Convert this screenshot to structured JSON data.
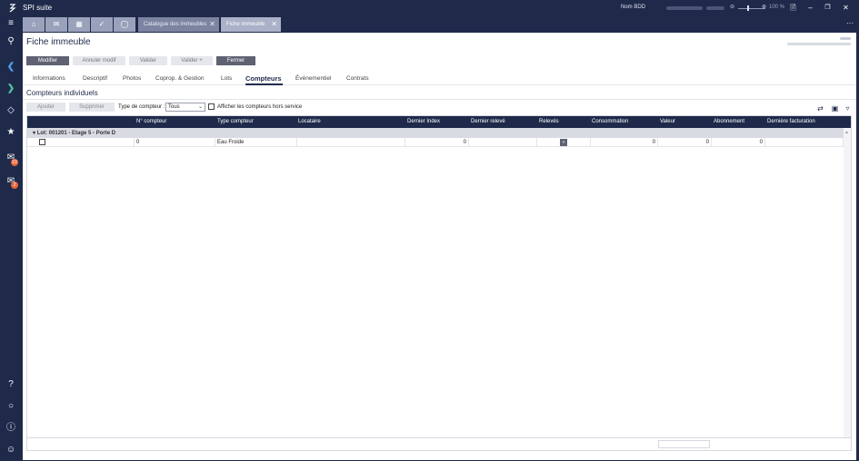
{
  "app": {
    "name": "SPI suite"
  },
  "titlebar": {
    "bdd_label": "Nom BDD",
    "zoom": "100 %",
    "zoom_minus": "⊖",
    "zoom_plus": "⊕",
    "icons": [
      "document-icon",
      "minimize-icon",
      "restore-icon",
      "close-icon"
    ]
  },
  "tabs": {
    "icon_tabs": [
      "home-icon",
      "mail-icon",
      "calendar-icon",
      "check-icon",
      "bell-icon"
    ],
    "doc_tabs": [
      {
        "label": "Catalogue des immeubles",
        "active": false
      },
      {
        "label": "Fiche immeuble",
        "active": true
      }
    ],
    "close_glyph": "✕",
    "more_glyph": "···"
  },
  "sidebar": {
    "badges": {
      "chat": "10",
      "mail": "2"
    }
  },
  "page": {
    "title": "Fiche immeuble",
    "actions": [
      {
        "label": "Modifier",
        "style": "dark"
      },
      {
        "label": "Annuler modif",
        "style": "light"
      },
      {
        "label": "Valider",
        "style": "light"
      },
      {
        "label": "Valider +",
        "style": "light"
      },
      {
        "label": "Fermer",
        "style": "dark"
      }
    ],
    "section_tabs": [
      "Informations",
      "Descriptif",
      "Photos",
      "Coprop. & Gestion",
      "Lots",
      "Compteurs",
      "Événementiel",
      "Contrats"
    ],
    "active_section": "Compteurs"
  },
  "compteurs": {
    "title": "Compteurs individuels",
    "toolbar": {
      "add": "Ajouter",
      "delete": "Supprimer",
      "type_label": "Type de compteur :",
      "type_value": "Tous",
      "show_hors_service": "Afficher les compteurs hors service"
    },
    "columns": [
      "N° compteur",
      "Type compteur",
      "Locataire",
      "Dernier Index",
      "Dernier relevé",
      "Relevés",
      "Consommation",
      "Valeur",
      "Abonnement",
      "Dernière facturation"
    ],
    "group": "Lot: 001201 - Etage 5 - Porte D",
    "rows": [
      {
        "numero": "0",
        "type": "Eau Froide",
        "locataire": "",
        "dernier_index": "0",
        "dernier_releve": "",
        "releves_btn": "»",
        "consommation": "0",
        "valeur": "0",
        "abonnement": "0",
        "derniere_facturation": ""
      }
    ]
  },
  "colors": {
    "navy": "#1f2a4b",
    "accent_badge": "#e8663a",
    "button_dark": "#5e6272"
  }
}
